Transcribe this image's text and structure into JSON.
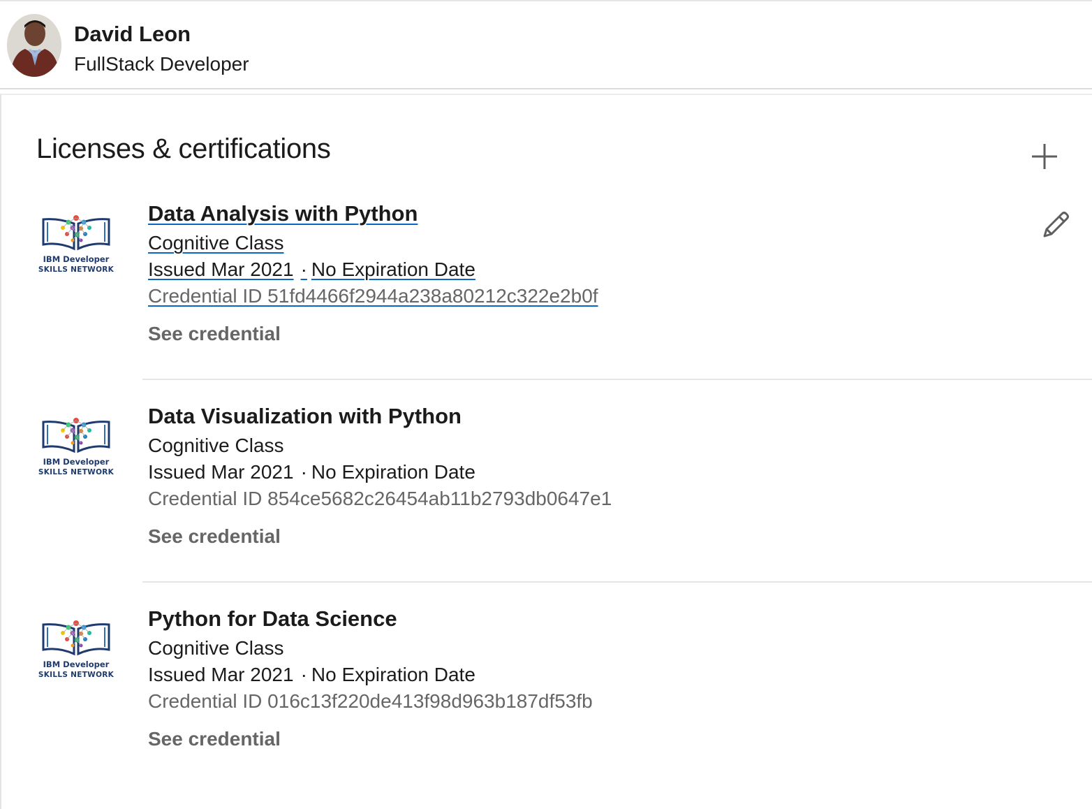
{
  "profile": {
    "name": "David Leon",
    "headline": "FullStack Developer"
  },
  "section": {
    "title": "Licenses & certifications",
    "add_icon": "plus-icon",
    "edit_icon": "pencil-icon"
  },
  "certifications": [
    {
      "title": "Data Analysis with Python",
      "issuer": "Cognitive Class",
      "issued": "Issued Mar 2021",
      "separator": "·",
      "expiration": "No Expiration Date",
      "credential_id": "Credential ID 51fd4466f2944a238a80212c322e2b0f",
      "see_credential": "See credential",
      "logo": {
        "line1": "IBM Developer",
        "line2": "SKILLS NETWORK"
      }
    },
    {
      "title": "Data Visualization with Python",
      "issuer": "Cognitive Class",
      "issued": "Issued Mar 2021",
      "separator": "·",
      "expiration": "No Expiration Date",
      "credential_id": "Credential ID 854ce5682c26454ab11b2793db0647e1",
      "see_credential": "See credential",
      "logo": {
        "line1": "IBM Developer",
        "line2": "SKILLS NETWORK"
      }
    },
    {
      "title": "Python for Data Science",
      "issuer": "Cognitive Class",
      "issued": "Issued Mar 2021",
      "separator": "·",
      "expiration": "No Expiration Date",
      "credential_id": "Credential ID 016c13f220de413f98d963b187df53fb",
      "see_credential": "See credential",
      "logo": {
        "line1": "IBM Developer",
        "line2": "SKILLS NETWORK"
      }
    }
  ],
  "colors": {
    "text_primary": "#1b1b1b",
    "text_secondary": "#666666",
    "link_underline": "#0a66c2",
    "logo_blue": "#1e3a6e"
  }
}
